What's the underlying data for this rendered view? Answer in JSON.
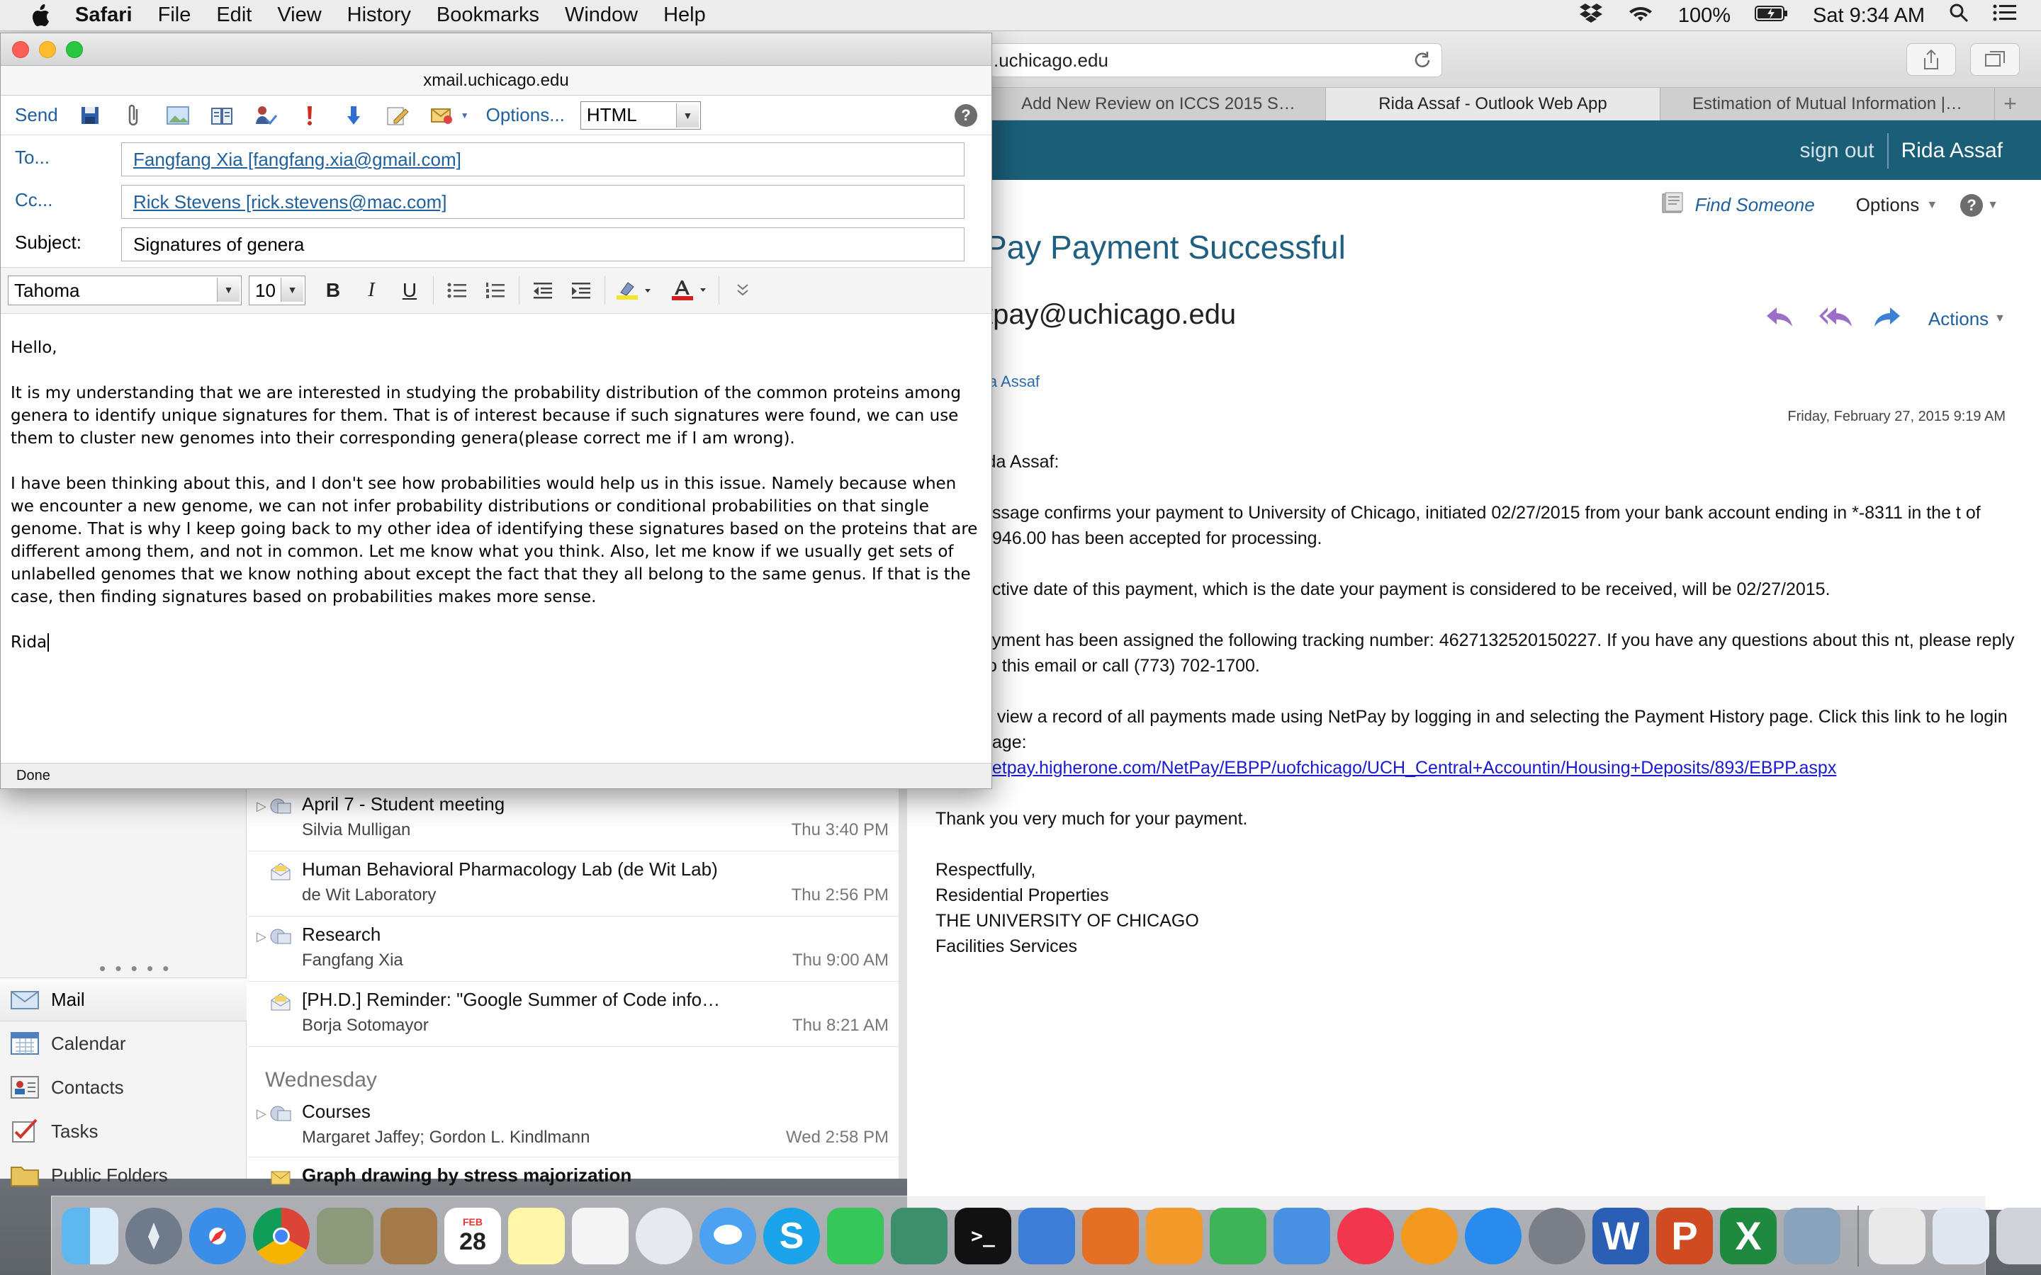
{
  "menubar": {
    "app_name": "Safari",
    "items": [
      "File",
      "Edit",
      "View",
      "History",
      "Bookmarks",
      "Window",
      "Help"
    ],
    "battery": "100%",
    "clock": "Sat 9:34 AM"
  },
  "safari": {
    "address": ".uchicago.edu",
    "tabs": [
      {
        "label": "Add New Review on ICCS 2015 S…",
        "active": false
      },
      {
        "label": "Rida Assaf - Outlook Web App",
        "active": true
      },
      {
        "label": "Estimation of Mutual Information |…",
        "active": false
      }
    ]
  },
  "owa": {
    "header": {
      "sign_out": "sign out",
      "user": "Rida Assaf"
    },
    "toolbar": {
      "find_someone": "Find Someone",
      "options": "Options"
    },
    "message": {
      "subject": "Pay Payment Successful",
      "from": "tpay@uchicago.edu",
      "to": "la Assaf",
      "actions_label": "Actions",
      "date": "Friday, February 27, 2015 9:19 AM",
      "body": [
        "ida Assaf:",
        "essage confirms your payment to University of Chicago, initiated 02/27/2015 from your bank account ending in *-8311 in the t of $946.00 has been accepted for processing.",
        "ective date of this payment, which is the date your payment is considered to be received, will be 02/27/2015.",
        "ayment has been assigned the following tracking number: 4627132520150227. If you have any questions about this nt, please reply to this email or call (773) 702-1700.",
        "n view a record of all payments made using NetPay by logging in and selecting the Payment History page. Click this link to he login page:"
      ],
      "link": "netpay.higherone.com/NetPay/EBPP/uofchicago/UCH_Central+Accountin/Housing+Deposits/893/EBPP.aspx",
      "thanks": "Thank you very much for your payment.",
      "signature": [
        "Respectfully,",
        "Residential Properties",
        "THE UNIVERSITY OF CHICAGO",
        "Facilities Services"
      ]
    },
    "nav": {
      "items": [
        "Mail",
        "Calendar",
        "Contacts",
        "Tasks",
        "Public Folders"
      ]
    },
    "message_list": {
      "rows": [
        {
          "subject": "April 7 - Student meeting",
          "from": "Silvia Mulligan",
          "time": "Thu 3:40 PM"
        },
        {
          "subject": "Human Behavioral Pharmacology Lab (de Wit Lab)",
          "from": "de Wit Laboratory",
          "time": "Thu 2:56 PM"
        },
        {
          "subject": "Research",
          "from": "Fangfang Xia",
          "time": "Thu 9:00 AM"
        },
        {
          "subject": "[PH.D.] Reminder: \"Google Summer of Code info…",
          "from": "Borja Sotomayor",
          "time": "Thu 8:21 AM"
        }
      ],
      "group_label": "Wednesday",
      "wed_rows": [
        {
          "subject": "Courses",
          "from": "Margaret Jaffey; Gordon L. Kindlmann",
          "time": "Wed 2:58 PM"
        },
        {
          "subject": "Graph drawing by stress majorization",
          "from": "",
          "time": ""
        }
      ]
    }
  },
  "compose": {
    "url": "xmail.uchicago.edu",
    "send_label": "Send",
    "options_label": "Options...",
    "format": "HTML",
    "to_label": "To...",
    "to_value": "Fangfang Xia [fangfang.xia@gmail.com]",
    "cc_label": "Cc...",
    "cc_value": "Rick Stevens [rick.stevens@mac.com]",
    "subject_label": "Subject:",
    "subject_value": "Signatures of genera",
    "font": "Tahoma",
    "font_size": "10",
    "fmt_bold": "B",
    "fmt_italic": "I",
    "fmt_underline": "U",
    "body": [
      "Hello,",
      "It is my understanding that we are interested in studying the probability distribution of the common proteins among genera to identify unique signatures for them. That is of interest because if such signatures were found, we can use them to cluster new genomes into their corresponding genera(please correct me if I am wrong).",
      "I have been thinking about this, and I don't see how probabilities would help us in this issue. Namely because when we encounter a new genome, we can not infer probability distributions or conditional probabilities on that single genome. That is why I keep going back to my other idea of identifying these signatures based on the proteins that are different among them, and not in common. Let me know what you think. Also, let me know if we usually get sets of unlabelled genomes that we know nothing about except the fact that they all belong to the same genus. If that is the case, then finding signatures based on probabilities makes more sense.",
      "Rida"
    ],
    "status": "Done"
  },
  "dock": {
    "calendar_day": "28",
    "calendar_month": "FEB"
  }
}
